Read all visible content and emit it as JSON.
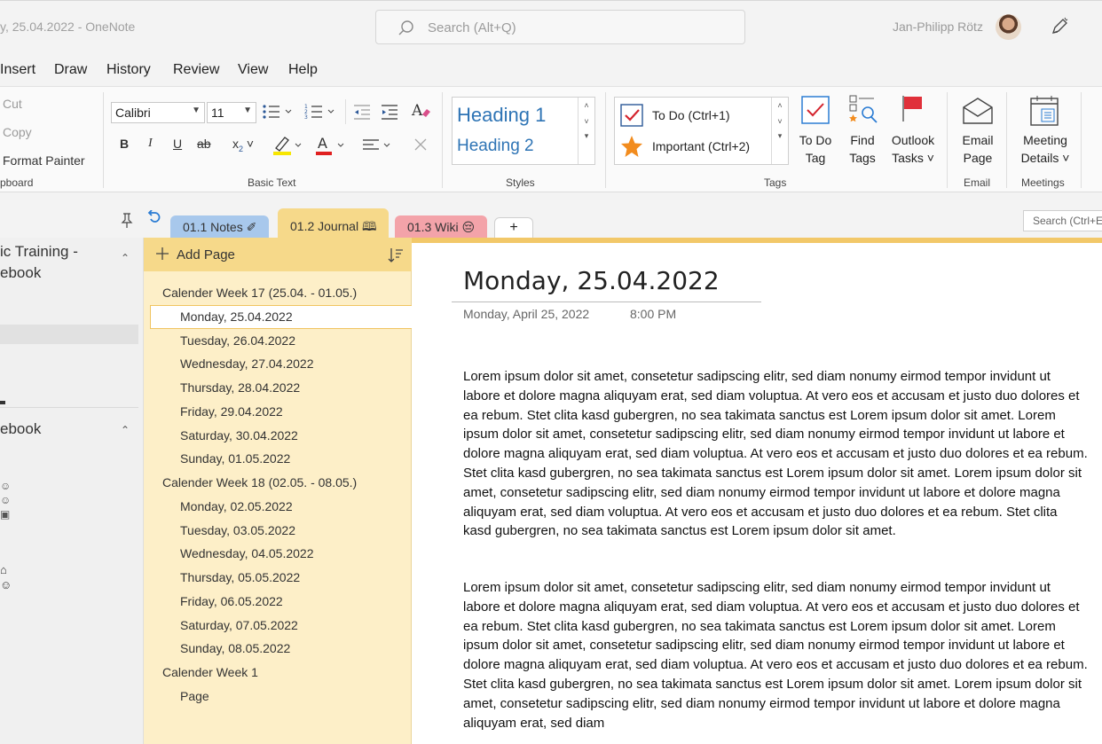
{
  "titlebar": {
    "title": "y, 25.04.2022  -  OneNote",
    "search_placeholder": "Search (Alt+Q)",
    "user_name": "Jan-Philipp Rötz"
  },
  "menu": [
    "Insert",
    "Draw",
    "History",
    "Review",
    "View",
    "Help"
  ],
  "ribbon": {
    "clipboard": {
      "cut": "Cut",
      "copy": "Copy",
      "format_painter": "Format Painter",
      "label": "pboard"
    },
    "basic_text": {
      "font": "Calibri",
      "size": "11",
      "label": "Basic Text"
    },
    "styles": {
      "heading1": "Heading 1",
      "heading2": "Heading 2",
      "label": "Styles"
    },
    "tags": {
      "todo": "To Do (Ctrl+1)",
      "important": "Important (Ctrl+2)",
      "todo_tag_1": "To Do",
      "todo_tag_2": "Tag",
      "find_tags_1": "Find",
      "find_tags_2": "Tags",
      "outlook_1": "Outlook",
      "outlook_2": "Tasks ˅",
      "label": "Tags"
    },
    "email": {
      "btn_1": "Email",
      "btn_2": "Page",
      "label": "Email"
    },
    "meetings": {
      "btn_1": "Meeting",
      "btn_2": "Details ˅",
      "label": "Meetings"
    }
  },
  "section_tabs": [
    {
      "label": "01.1 Notes ✐",
      "color": "#a8c8ec"
    },
    {
      "label": "01.2 Journal 🕮",
      "color": "#f6d98a"
    },
    {
      "label": "01.3 Wiki 😔",
      "color": "#f3a3a9"
    },
    {
      "label": "+",
      "color": "#ffffff"
    }
  ],
  "page_search_placeholder": "Search (Ctrl+E)",
  "nav": {
    "notebook1_line1": "ic Training -",
    "notebook1_line2": "ebook",
    "notebook2": "ebook"
  },
  "page_list": {
    "add_page": "Add Page",
    "items": [
      {
        "label": "Calender Week 17 (25.04. - 01.05.)",
        "level": 0
      },
      {
        "label": "Monday, 25.04.2022",
        "level": 1,
        "selected": true
      },
      {
        "label": "Tuesday, 26.04.2022",
        "level": 1
      },
      {
        "label": "Wednesday, 27.04.2022",
        "level": 1
      },
      {
        "label": "Thursday, 28.04.2022",
        "level": 1
      },
      {
        "label": "Friday, 29.04.2022",
        "level": 1
      },
      {
        "label": "Saturday, 30.04.2022",
        "level": 1
      },
      {
        "label": "Sunday, 01.05.2022",
        "level": 1
      },
      {
        "label": "Calender Week 18 (02.05. - 08.05.)",
        "level": 0
      },
      {
        "label": "Monday, 02.05.2022",
        "level": 1
      },
      {
        "label": "Tuesday, 03.05.2022",
        "level": 1
      },
      {
        "label": "Wednesday, 04.05.2022",
        "level": 1
      },
      {
        "label": "Thursday, 05.05.2022",
        "level": 1
      },
      {
        "label": "Friday, 06.05.2022",
        "level": 1
      },
      {
        "label": "Saturday, 07.05.2022",
        "level": 1
      },
      {
        "label": "Sunday, 08.05.2022",
        "level": 1
      },
      {
        "label": "Calender Week 1",
        "level": 0
      },
      {
        "label": "Page",
        "level": 1
      }
    ]
  },
  "page": {
    "title": "Monday, 25.04.2022",
    "date": "Monday, April 25, 2022",
    "time": "8:00 PM",
    "paragraphs": [
      "Lorem ipsum dolor sit amet, consetetur sadipscing elitr, sed diam nonumy eirmod tempor invidunt ut labore et dolore magna aliquyam erat, sed diam voluptua. At vero eos et accusam et justo duo dolores et ea rebum. Stet clita kasd gubergren, no sea takimata sanctus est Lorem ipsum dolor sit amet. Lorem ipsum dolor sit amet, consetetur sadipscing elitr, sed diam nonumy eirmod tempor invidunt ut labore et dolore magna aliquyam erat, sed diam voluptua. At vero eos et accusam et justo duo dolores et ea rebum. Stet clita kasd gubergren, no sea takimata sanctus est Lorem ipsum dolor sit amet. Lorem ipsum dolor sit amet, consetetur sadipscing elitr, sed diam nonumy eirmod tempor invidunt ut labore et dolore magna aliquyam erat, sed diam voluptua. At vero eos et accusam et justo duo dolores et ea rebum. Stet clita kasd gubergren, no sea takimata sanctus est Lorem ipsum dolor sit amet.",
      "Lorem ipsum dolor sit amet, consetetur sadipscing elitr, sed diam nonumy eirmod tempor invidunt ut labore et dolore magna aliquyam erat, sed diam voluptua. At vero eos et accusam et justo duo dolores et ea rebum. Stet clita kasd gubergren, no sea takimata sanctus est Lorem ipsum dolor sit amet. Lorem ipsum dolor sit amet, consetetur sadipscing elitr, sed diam nonumy eirmod tempor invidunt ut labore et dolore magna aliquyam erat, sed diam voluptua. At vero eos et accusam et justo duo dolores et ea rebum. Stet clita kasd gubergren, no sea takimata sanctus est Lorem ipsum dolor sit amet. Lorem ipsum dolor sit amet, consetetur sadipscing elitr, sed diam nonumy eirmod tempor invidunt ut labore et dolore magna aliquyam erat, sed diam"
    ]
  },
  "colors": {
    "accent_yellow": "#f2c869",
    "tab_blue": "#a8c8ec",
    "tab_red": "#f3a3a9",
    "heading_blue": "#2e74b5"
  }
}
